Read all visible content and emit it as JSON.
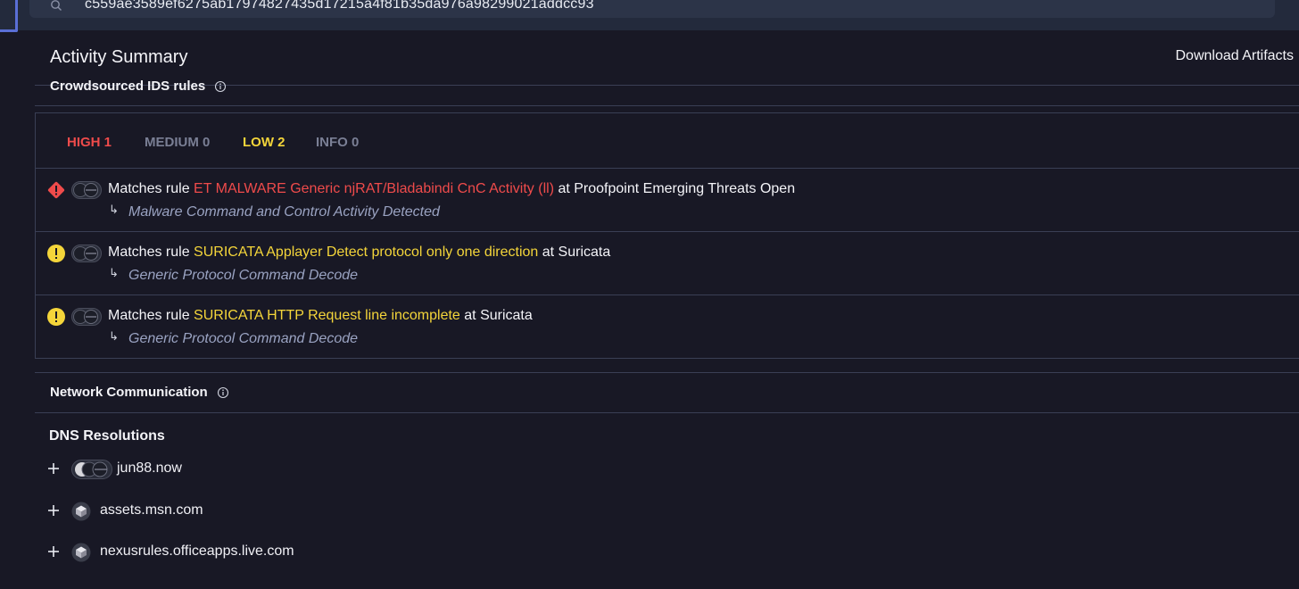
{
  "search": {
    "value": "c559ae3589ef6275ab17974827435d17215a4f81b35da976a98299021addcc93",
    "icon": "search-icon"
  },
  "header": {
    "title": "Activity Summary",
    "download_label": "Download Artifacts"
  },
  "ids": {
    "title": "Crowdsourced IDS rules",
    "tabs": [
      {
        "label": "HIGH 1",
        "color": "#ef4b4b"
      },
      {
        "label": "MEDIUM 0",
        "color": "#7a7f95"
      },
      {
        "label": "LOW 2",
        "color": "#f4d53a"
      },
      {
        "label": "INFO 0",
        "color": "#7a7f95"
      }
    ],
    "rules": [
      {
        "severity": "high",
        "prefix": "Matches rule",
        "name": "ET MALWARE Generic njRAT/Bladabindi CnC Activity (ll)",
        "suffix": "at Proofpoint Emerging Threats Open",
        "category": "Malware Command and Control Activity Detected"
      },
      {
        "severity": "low",
        "prefix": "Matches rule",
        "name": "SURICATA Applayer Detect protocol only one direction",
        "suffix": "at Suricata",
        "category": "Generic Protocol Command Decode"
      },
      {
        "severity": "low",
        "prefix": "Matches rule",
        "name": "SURICATA HTTP Request line incomplete",
        "suffix": "at Suricata",
        "category": "Generic Protocol Command Decode"
      }
    ],
    "sub_arrow": "↳"
  },
  "network": {
    "title": "Network Communication",
    "dns_title": "DNS Resolutions",
    "dns": [
      {
        "host": "jun88.now",
        "icon": "toggle-icon"
      },
      {
        "host": "assets.msn.com",
        "icon": "cube-icon"
      },
      {
        "host": "nexusrules.officeapps.live.com",
        "icon": "cube-icon"
      }
    ]
  },
  "colors": {
    "background": "#181825",
    "high": "#ef4b4b",
    "low": "#f4d53a",
    "muted": "#7a7f95",
    "category": "#9aa3c2",
    "accent": "#5a6fd6"
  }
}
